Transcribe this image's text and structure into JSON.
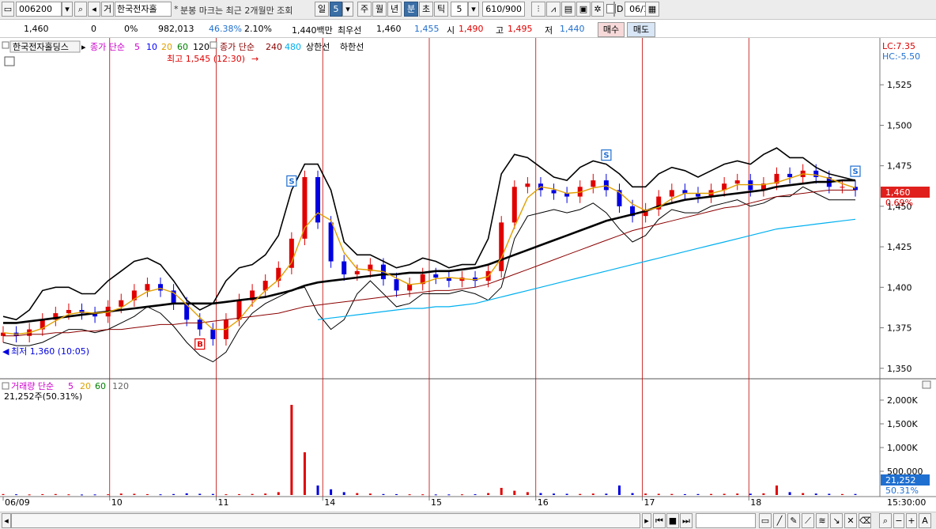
{
  "toolbar": {
    "code": "006200",
    "type_label": "거",
    "stock_name": "한국전자홀",
    "notice": "분봉 마크는 최근 2개월만 조회",
    "periods": [
      "일",
      "5",
      "주",
      "월",
      "년",
      "분",
      "초",
      "틱"
    ],
    "active_period": "분",
    "interval": "5",
    "count": "610/900",
    "date": "06/18",
    "date_check": "D"
  },
  "quote": {
    "price": "1,460",
    "change": "0",
    "change_pct": "0%",
    "volume": "982,013",
    "volume_ratio": "46.38%",
    "turnover": "2.10%",
    "amount": "1,440백만",
    "best_label": "최우선",
    "best_ask": "1,460",
    "best_bid": "1,455",
    "open_label": "시",
    "open": "1,490",
    "high_label": "고",
    "high": "1,495",
    "low_label": "저",
    "low": "1,440",
    "buy_label": "매수",
    "sell_label": "매도"
  },
  "legend": {
    "name": "한국전자홀딩스",
    "ma_prefix": "종가 단순",
    "ma_periods": [
      "5",
      "10",
      "20",
      "60",
      "120"
    ],
    "ma2_prefix": "종가 단순",
    "ma2_periods": [
      "240",
      "480"
    ],
    "band_upper": "상한선",
    "band_lower": "하한선",
    "lc": "LC:7.35",
    "hc": "HC:-5.50",
    "max_note": "최고 1,545 (12:30)",
    "min_note": "최저 1,360 (10:05)",
    "vol_prefix": "거래량 단순",
    "vol_periods": [
      "5",
      "20",
      "60",
      "120"
    ],
    "vol_value": "21,252주(50.31%)"
  },
  "colors": {
    "ma5": "#cc00cc",
    "ma10": "#0000ff",
    "ma20": "#e0a000",
    "ma60": "#008000",
    "ma120": "#000000",
    "ma240": "#8b0000",
    "ma480": "#00b0f0",
    "band": "#000000",
    "up": "#e00000",
    "down": "#0000e0",
    "accent_blue": "#1f6fd0"
  },
  "chart_data": {
    "type": "candlestick",
    "price_axis": {
      "ticks": [
        "1,525",
        "1,500",
        "1,475",
        "1,450",
        "1,425",
        "1,400",
        "1,375",
        "1,350"
      ],
      "ylim": [
        1345,
        1550
      ]
    },
    "volume_axis": {
      "ticks": [
        "2,000K",
        "1,500K",
        "1,000K",
        "500,000"
      ],
      "ylim": [
        0,
        2300000
      ]
    },
    "x_labels": [
      "06/09",
      "10",
      "11",
      "14",
      "15",
      "16",
      "17",
      "18"
    ],
    "time_label": "15:30:00",
    "last_price": "1,460",
    "last_change": "0.69%",
    "last_volume": "21,252",
    "last_volume_pct": "50.31%",
    "markers": [
      "S",
      "B",
      "S",
      "S"
    ],
    "series": {
      "close": [
        1372,
        1370,
        1374,
        1380,
        1384,
        1386,
        1384,
        1382,
        1388,
        1392,
        1398,
        1402,
        1398,
        1390,
        1380,
        1374,
        1368,
        1380,
        1392,
        1398,
        1404,
        1412,
        1430,
        1468,
        1440,
        1416,
        1408,
        1410,
        1414,
        1405,
        1398,
        1402,
        1408,
        1406,
        1404,
        1406,
        1404,
        1410,
        1440,
        1462,
        1464,
        1460,
        1458,
        1456,
        1462,
        1466,
        1460,
        1450,
        1444,
        1448,
        1456,
        1460,
        1458,
        1456,
        1460,
        1464,
        1466,
        1460,
        1464,
        1470,
        1468,
        1472,
        1468,
        1462,
        1462,
        1460
      ],
      "ma120": [
        1378,
        1378,
        1379,
        1380,
        1381,
        1382,
        1383,
        1384,
        1385,
        1386,
        1387,
        1388,
        1389,
        1390,
        1390,
        1390,
        1390,
        1391,
        1392,
        1393,
        1394,
        1396,
        1398,
        1401,
        1403,
        1404,
        1405,
        1406,
        1407,
        1408,
        1408,
        1409,
        1409,
        1410,
        1410,
        1411,
        1412,
        1414,
        1417,
        1420,
        1423,
        1426,
        1429,
        1432,
        1435,
        1438,
        1441,
        1443,
        1445,
        1447,
        1450,
        1452,
        1454,
        1455,
        1456,
        1457,
        1458,
        1459,
        1460,
        1462,
        1463,
        1464,
        1465,
        1465,
        1466,
        1466
      ],
      "ma240": [
        1370,
        1370,
        1371,
        1371,
        1372,
        1372,
        1373,
        1373,
        1374,
        1374,
        1375,
        1376,
        1377,
        1377,
        1378,
        1378,
        1379,
        1380,
        1381,
        1382,
        1383,
        1384,
        1386,
        1388,
        1389,
        1390,
        1391,
        1392,
        1393,
        1394,
        1395,
        1396,
        1397,
        1398,
        1398,
        1399,
        1400,
        1402,
        1405,
        1408,
        1411,
        1414,
        1417,
        1420,
        1423,
        1426,
        1429,
        1432,
        1435,
        1437,
        1439,
        1441,
        1443,
        1445,
        1447,
        1449,
        1450,
        1452,
        1454,
        1456,
        1457,
        1458,
        1459,
        1460,
        1460,
        1460
      ],
      "ma480": [
        null,
        null,
        null,
        null,
        null,
        null,
        null,
        null,
        null,
        null,
        null,
        null,
        null,
        null,
        null,
        null,
        null,
        null,
        null,
        null,
        null,
        null,
        null,
        null,
        1380,
        1381,
        1382,
        1383,
        1384,
        1385,
        1386,
        1387,
        1387,
        1388,
        1388,
        1389,
        1390,
        1392,
        1394,
        1396,
        1398,
        1400,
        1402,
        1404,
        1406,
        1408,
        1410,
        1412,
        1414,
        1416,
        1418,
        1420,
        1422,
        1424,
        1426,
        1428,
        1430,
        1432,
        1434,
        1436,
        1437,
        1438,
        1439,
        1440,
        1441,
        1442
      ],
      "band_upper": [
        1382,
        1380,
        1386,
        1398,
        1400,
        1400,
        1396,
        1396,
        1404,
        1410,
        1416,
        1418,
        1414,
        1404,
        1392,
        1386,
        1390,
        1404,
        1412,
        1414,
        1420,
        1432,
        1460,
        1476,
        1476,
        1460,
        1428,
        1420,
        1420,
        1416,
        1412,
        1414,
        1418,
        1416,
        1412,
        1414,
        1414,
        1430,
        1470,
        1482,
        1480,
        1474,
        1468,
        1466,
        1474,
        1478,
        1476,
        1470,
        1462,
        1462,
        1470,
        1474,
        1472,
        1468,
        1472,
        1476,
        1478,
        1476,
        1482,
        1486,
        1480,
        1480,
        1474,
        1470,
        1468,
        1466
      ],
      "band_lower": [
        1366,
        1364,
        1364,
        1366,
        1370,
        1374,
        1374,
        1372,
        1374,
        1378,
        1382,
        1388,
        1384,
        1376,
        1366,
        1358,
        1354,
        1360,
        1374,
        1384,
        1390,
        1394,
        1398,
        1400,
        1384,
        1374,
        1380,
        1396,
        1404,
        1396,
        1388,
        1390,
        1396,
        1396,
        1396,
        1398,
        1396,
        1392,
        1400,
        1430,
        1444,
        1446,
        1448,
        1446,
        1448,
        1452,
        1446,
        1436,
        1428,
        1432,
        1442,
        1448,
        1446,
        1446,
        1450,
        1452,
        1454,
        1450,
        1452,
        1456,
        1456,
        1462,
        1458,
        1454,
        1454,
        1454
      ],
      "volume": [
        20000,
        15000,
        12000,
        18000,
        20000,
        14000,
        10000,
        12000,
        15000,
        30000,
        25000,
        18000,
        14000,
        20000,
        35000,
        25000,
        22000,
        16000,
        18000,
        22000,
        30000,
        60000,
        1900000,
        900000,
        200000,
        120000,
        60000,
        40000,
        30000,
        20000,
        18000,
        15000,
        14000,
        12000,
        12000,
        14000,
        16000,
        40000,
        150000,
        90000,
        60000,
        40000,
        30000,
        25000,
        22000,
        30000,
        28000,
        200000,
        40000,
        30000,
        25000,
        22000,
        18000,
        20000,
        22000,
        25000,
        30000,
        28000,
        35000,
        200000,
        60000,
        40000,
        30000,
        25000,
        20000,
        21252
      ]
    }
  }
}
